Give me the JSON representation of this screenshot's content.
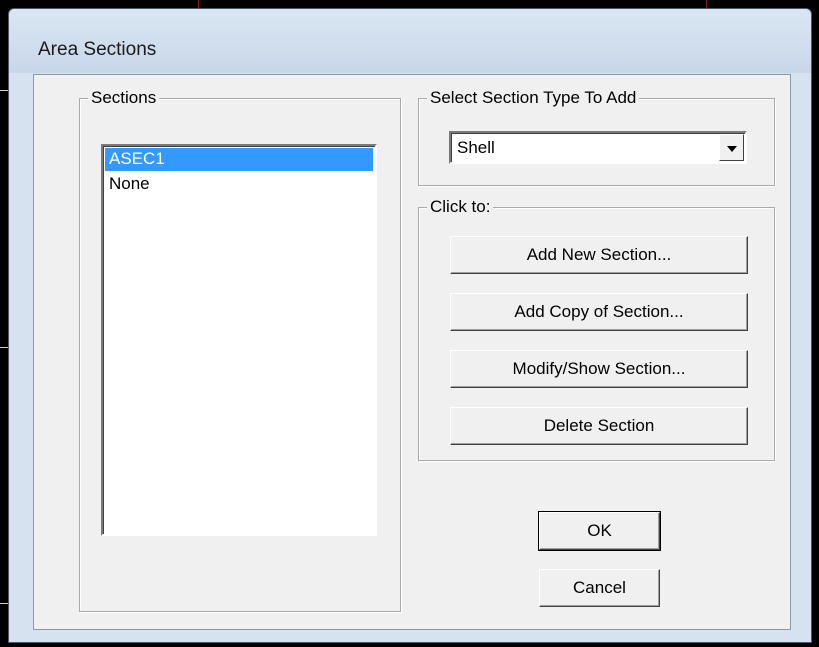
{
  "window": {
    "title": "Area Sections"
  },
  "sections_group": {
    "legend": "Sections",
    "items": [
      {
        "label": "ASEC1",
        "selected": true
      },
      {
        "label": "None",
        "selected": false
      }
    ]
  },
  "section_type_group": {
    "legend": "Select Section Type To Add",
    "selected_value": "Shell"
  },
  "click_group": {
    "legend": "Click to:",
    "buttons": {
      "add_new": "Add New Section...",
      "add_copy": "Add Copy of Section...",
      "modify_show": "Modify/Show Section...",
      "delete": "Delete Section"
    }
  },
  "dialog_buttons": {
    "ok": "OK",
    "cancel": "Cancel"
  },
  "colors": {
    "selection": "#3399ff",
    "window_frame": "#d6e2ef",
    "face": "#f0f0f0"
  }
}
